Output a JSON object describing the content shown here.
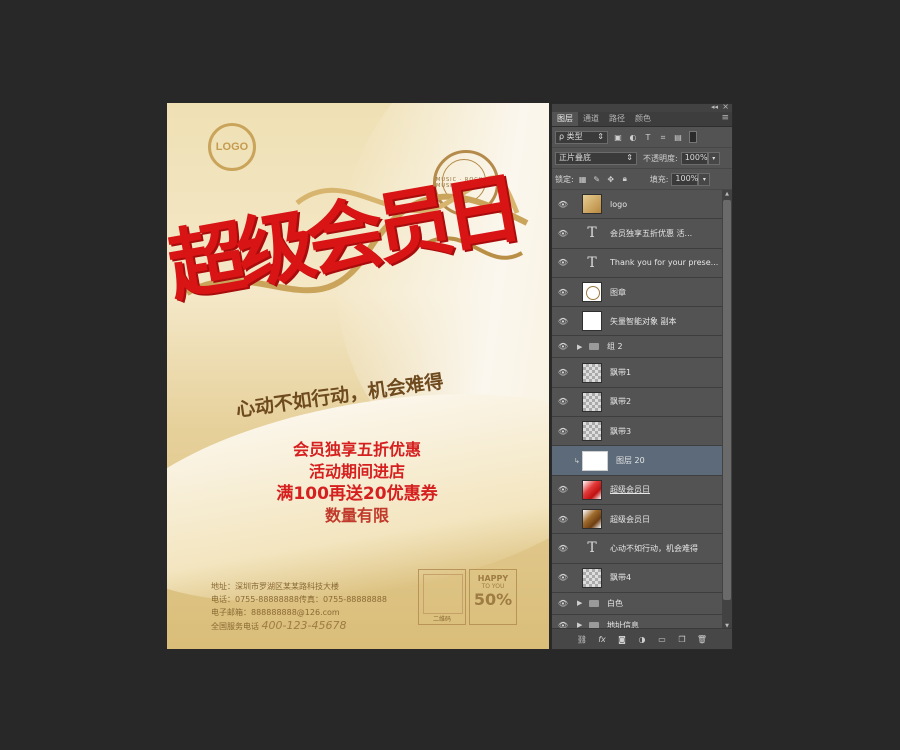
{
  "poster": {
    "logo_text": "LOGO",
    "stamp_text": "MUSIC · ROCK · MUSIC",
    "title_art": "超级会员日",
    "slogan": "心动不如行动，机会难得",
    "offer_line1": "会员独享五折优惠",
    "offer_line2": "活动期间进店",
    "offer_line3": "满100再送20优惠券",
    "offer_line4": "数量有限",
    "address": "地址：深圳市罗湖区某某路科技大楼",
    "phone": "电话：0755-88888888传真：0755-88888888",
    "email": "电子邮箱：888888888@126.com",
    "hotline_label": "全国服务电话",
    "hotline": "400-123-45678",
    "qr_label": "二维码",
    "happy_line1": "HAPPY",
    "happy_line2": "TO YOU",
    "happy_line3": "50%"
  },
  "panel": {
    "collapse_glyph": "◂◂",
    "close_glyph": "×",
    "menu_glyph": "≡",
    "tabs": [
      {
        "label": "图层"
      },
      {
        "label": "通道"
      },
      {
        "label": "路径"
      },
      {
        "label": "颜色"
      }
    ],
    "filter_label": "ρ 类型",
    "blend_mode": "正片叠底",
    "opacity_label": "不透明度:",
    "opacity_value": "100%",
    "lock_label": "锁定:",
    "fill_label": "填充:",
    "fill_value": "100%",
    "layers": [
      {
        "name": "logo"
      },
      {
        "name": "会员独享五折优惠 活..."
      },
      {
        "name": "Thank you for your prese..."
      },
      {
        "name": "图章"
      },
      {
        "name": "矢量智能对象 副本"
      },
      {
        "name": "组 2"
      },
      {
        "name": "飘带1"
      },
      {
        "name": "飘带2"
      },
      {
        "name": "飘带3"
      },
      {
        "name": "图层 20"
      },
      {
        "name": "超级会员日"
      },
      {
        "name": "超级会员日"
      },
      {
        "name": "心动不如行动，机会难得"
      },
      {
        "name": "飘带4"
      },
      {
        "name": "白色"
      },
      {
        "name": "地址信息"
      }
    ],
    "bottom_icons": [
      "link-icon",
      "fx-icon",
      "mask-icon",
      "adjustment-icon",
      "folder-icon",
      "new-layer-icon",
      "trash-icon"
    ]
  },
  "colors": {
    "canvas_bg": "#282828",
    "panel_bg": "#535353",
    "selected_row": "#5c6a79",
    "title_red": "#d81414",
    "gold": "#c9a45a"
  }
}
